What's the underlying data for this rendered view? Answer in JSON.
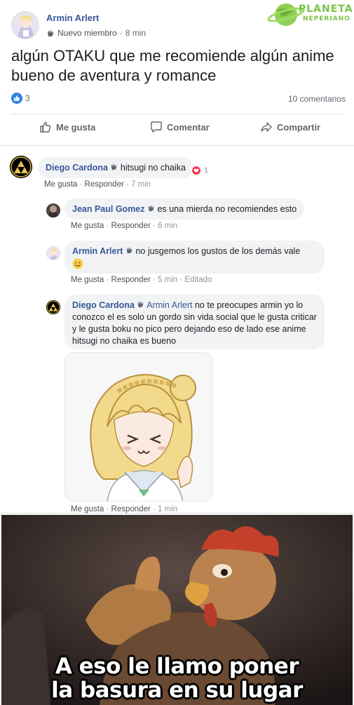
{
  "post": {
    "author": "Armin Arlert",
    "badge": "Nuevo miembro",
    "separator": "·",
    "time": "8 min",
    "text": "algún OTAKU que me recomiende algún anime bueno de aventura y romance",
    "reaction_count": "3",
    "comment_count": "10 comentarios",
    "actions": {
      "like": "Me gusta",
      "comment": "Comentar",
      "share": "Compartir"
    }
  },
  "watermark": {
    "line1": "PLANETA",
    "line2": "NEPERIANO"
  },
  "comments": [
    {
      "author": "Diego Cardona",
      "text": "hitsugi no chaika",
      "like": "Me gusta",
      "reply": "Responder",
      "time": "7 min",
      "reactions": "1"
    },
    {
      "author": "Jean Paul Gomez",
      "text": "es una mierda no recomiendes esto",
      "like": "Me gusta",
      "reply": "Responder",
      "time": "6 min"
    },
    {
      "author": "Armin Arlert",
      "text": "no jusgemos los gustos de los demás vale",
      "like": "Me gusta",
      "reply": "Responder",
      "time": "5 min",
      "edited": "Editado"
    },
    {
      "author": "Diego Cardona",
      "mention": "Armin Arlert",
      "text": "no te preocupes armin yo lo conozco el es solo un gordo sin vida social que le gusta criticar y le gusta boku no pico pero dejando eso de lado ese anime hitsugi no chaika es bueno",
      "like": "Me gusta",
      "reply": "Responder",
      "time": "1 min"
    }
  ],
  "meme": {
    "line1": "A eso le llamo poner",
    "line2": "la basura en su lugar"
  },
  "colors": {
    "link": "#385898",
    "like_blue": "#2d7fea",
    "heart_red": "#f33e58",
    "bubble": "#f2f3f5",
    "watermark_green": "#7cc24a"
  }
}
